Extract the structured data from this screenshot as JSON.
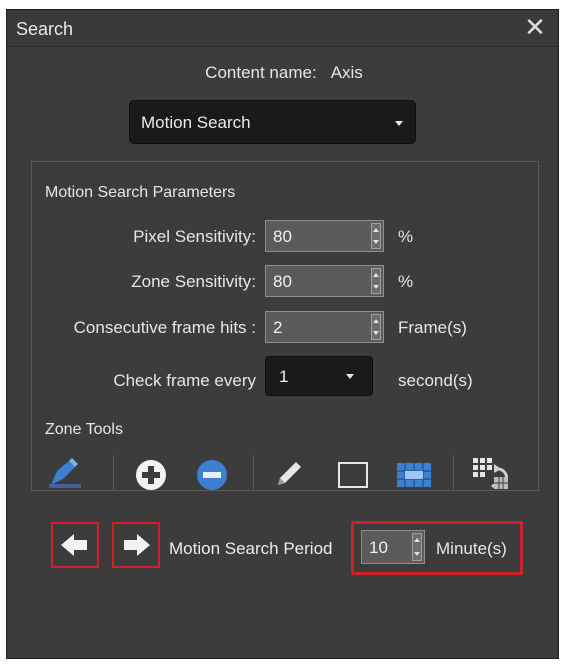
{
  "window": {
    "title": "Search"
  },
  "content": {
    "name_label": "Content name:",
    "name_value": "Axis"
  },
  "mode_select": {
    "value": "Motion Search"
  },
  "params": {
    "title": "Motion Search Parameters",
    "pixel_sensitivity": {
      "label": "Pixel Sensitivity:",
      "value": "80",
      "unit": "%"
    },
    "zone_sensitivity": {
      "label": "Zone Sensitivity:",
      "value": "80",
      "unit": "%"
    },
    "consecutive_hits": {
      "label": "Consecutive frame hits :",
      "value": "2",
      "unit": "Frame(s)"
    },
    "check_frame": {
      "label": "Check frame every",
      "value": "1",
      "unit": "second(s)"
    }
  },
  "zone_tools": {
    "title": "Zone Tools",
    "icons": [
      "zone-brush-icon",
      "plus-circle-icon",
      "minus-circle-icon",
      "pencil-icon",
      "rectangle-icon",
      "grid-select-icon",
      "grid-refresh-icon"
    ]
  },
  "period": {
    "label": "Motion Search Period",
    "value": "10",
    "unit": "Minute(s)"
  },
  "colors": {
    "panel": "#3c3c3c",
    "highlight": "#d0202a",
    "tool_blue": "#3d7fd1"
  }
}
